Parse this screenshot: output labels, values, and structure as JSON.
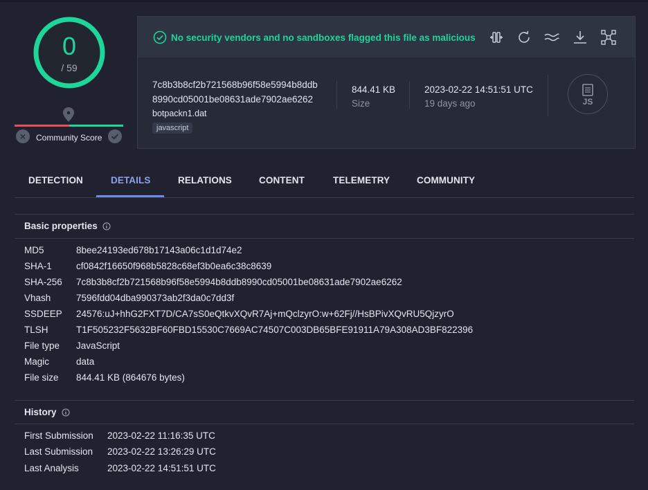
{
  "score": {
    "detections": "0",
    "total": "/ 59"
  },
  "community": {
    "label": "Community Score"
  },
  "banner": {
    "message": "No security vendors and no sandboxes flagged this file as malicious"
  },
  "file": {
    "hash_line1": "7c8b3b8cf2b721568b96f58e5994b8ddb",
    "hash_line2": "8990cd05001be08631ade7902ae6262",
    "name": "botpackn1.dat",
    "tag": "javascript",
    "size_value": "844.41 KB",
    "size_label": "Size",
    "date_value": "2023-02-22 14:51:51 UTC",
    "date_label": "19 days ago",
    "type_badge": "JS"
  },
  "tabs": [
    {
      "label": "DETECTION"
    },
    {
      "label": "DETAILS"
    },
    {
      "label": "RELATIONS"
    },
    {
      "label": "CONTENT"
    },
    {
      "label": "TELEMETRY"
    },
    {
      "label": "COMMUNITY"
    }
  ],
  "basic": {
    "title": "Basic properties",
    "rows": [
      {
        "label": "MD5",
        "value": "8bee24193ed678b17143a06c1d1d74e2"
      },
      {
        "label": "SHA-1",
        "value": "cf0842f16650f968b5828c68ef3b0ea6c38c8639"
      },
      {
        "label": "SHA-256",
        "value": "7c8b3b8cf2b721568b96f58e5994b8ddb8990cd05001be08631ade7902ae6262"
      },
      {
        "label": "Vhash",
        "value": "7596fdd04dba990373ab2f3da0c7dd3f"
      },
      {
        "label": "SSDEEP",
        "value": "24576:uJ+hhG2FXT7D/CA7sS0eQtkvXQvR7Aj+mQclzyrO:w+62Fj//HsBPivXQvRU5QjzyrO"
      },
      {
        "label": "TLSH",
        "value": "T1F505232F5632BF60FBD15530C7669AC74507C003DB65BFE91911A79A308AD3BF822396"
      },
      {
        "label": "File type",
        "value": "JavaScript"
      },
      {
        "label": "Magic",
        "value": "data"
      },
      {
        "label": "File size",
        "value": "844.41 KB (864676 bytes)"
      }
    ]
  },
  "history": {
    "title": "History",
    "rows": [
      {
        "label": "First Submission",
        "value": "2023-02-22 11:16:35 UTC"
      },
      {
        "label": "Last Submission",
        "value": "2023-02-22 13:26:29 UTC"
      },
      {
        "label": "Last Analysis",
        "value": "2023-02-22 14:51:51 UTC"
      }
    ]
  },
  "colors": {
    "accent_green": "#1ed69a",
    "accent_blue": "#8da2f0",
    "alert_red": "#e7505b",
    "background": "#20232f"
  },
  "icons": [
    "compare-icon",
    "reanalyze-icon",
    "similar-icon",
    "download-icon",
    "graph-icon",
    "shield-check-icon",
    "info-icon",
    "map-pin-icon"
  ]
}
